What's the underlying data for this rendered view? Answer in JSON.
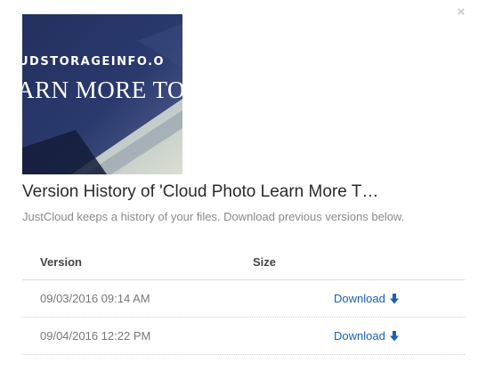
{
  "dialog": {
    "close_label": "×",
    "thumbnail": {
      "text_line1": "UDSTORAGEINFO.O",
      "text_line2": "ARN MORE TOD"
    },
    "title": "Version History of 'Cloud Photo Learn More T…",
    "subtitle": "JustCloud keeps a history of your files. Download previous versions below."
  },
  "table": {
    "columns": [
      "Version",
      "Size"
    ],
    "rows": [
      {
        "date": "09/03/2016 09:14 AM",
        "size": "",
        "action": "Download"
      },
      {
        "date": "09/04/2016 12:22 PM",
        "size": "",
        "action": "Download"
      }
    ]
  },
  "colors": {
    "link": "#1a5fb4",
    "thumbnail_bg": "#1f2f5a"
  },
  "icons": {
    "close": "close-icon",
    "download": "arrow-down-icon"
  }
}
